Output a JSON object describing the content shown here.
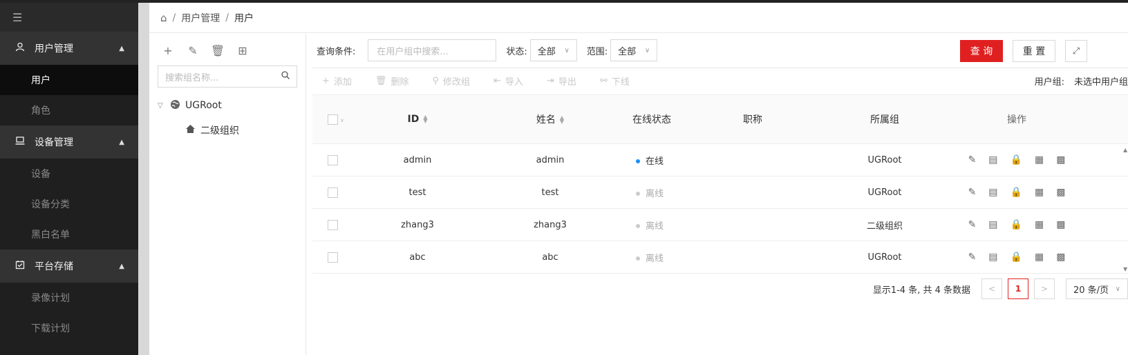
{
  "sidebar": {
    "groups": [
      {
        "label": "用户管理",
        "icon": "user-icon",
        "items": [
          {
            "label": "用户",
            "active": true
          },
          {
            "label": "角色"
          }
        ]
      },
      {
        "label": "设备管理",
        "icon": "monitor-icon",
        "items": [
          {
            "label": "设备"
          },
          {
            "label": "设备分类"
          },
          {
            "label": "黑白名单"
          }
        ]
      },
      {
        "label": "平台存储",
        "icon": "calendar-check-icon",
        "items": [
          {
            "label": "录像计划"
          },
          {
            "label": "下载计划"
          }
        ]
      }
    ]
  },
  "breadcrumb": {
    "parent": "用户管理",
    "current": "用户",
    "sep": "/"
  },
  "tree": {
    "search_placeholder": "搜索组名称...",
    "nodes": [
      {
        "label": "UGRoot",
        "icon": "globe-icon"
      },
      {
        "label": "二级组织",
        "icon": "home-icon"
      }
    ]
  },
  "filter": {
    "condition_label": "查询条件:",
    "search_placeholder": "在用户组中搜索...",
    "status_label": "状态:",
    "status_value": "全部",
    "scope_label": "范围:",
    "scope_value": "全部",
    "query_button": "查 询",
    "reset_button": "重 置"
  },
  "toolbar": {
    "add": "添加",
    "delete": "删除",
    "modify_group": "修改组",
    "import": "导入",
    "export": "导出",
    "offline": "下线",
    "user_group_label": "用户组:",
    "user_group_value": "未选中用户组"
  },
  "table": {
    "headers": {
      "id": "ID",
      "name": "姓名",
      "status": "在线状态",
      "title": "职称",
      "group": "所属组",
      "ops": "操作"
    },
    "rows": [
      {
        "id": "admin",
        "name": "admin",
        "status": "在线",
        "online": true,
        "title": "",
        "group": "UGRoot"
      },
      {
        "id": "test",
        "name": "test",
        "status": "离线",
        "online": false,
        "title": "",
        "group": "UGRoot"
      },
      {
        "id": "zhang3",
        "name": "zhang3",
        "status": "离线",
        "online": false,
        "title": "",
        "group": "二级组织"
      },
      {
        "id": "abc",
        "name": "abc",
        "status": "离线",
        "online": false,
        "title": "",
        "group": "UGRoot"
      }
    ]
  },
  "pagination": {
    "info": "显示1-4 条, 共 4 条数据",
    "current_page": "1",
    "page_size": "20 条/页"
  },
  "colors": {
    "accent": "#e02020",
    "online": "#1890ff",
    "offline": "#cccccc"
  }
}
